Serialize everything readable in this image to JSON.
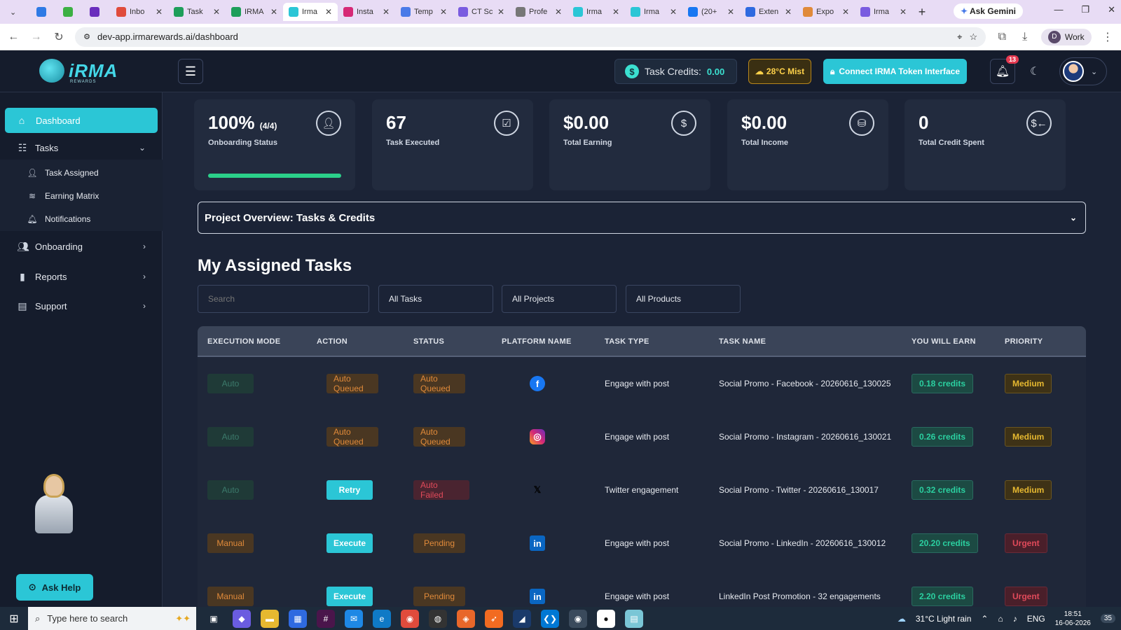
{
  "browser": {
    "tabs": [
      {
        "title": "",
        "color": "#2f7ae5"
      },
      {
        "title": "",
        "color": "#3cb043"
      },
      {
        "title": "",
        "color": "#6a2dbd"
      },
      {
        "title": "Inbo",
        "color": "#e04b3c"
      },
      {
        "title": "Task",
        "color": "#1e9e5a"
      },
      {
        "title": "IRMA",
        "color": "#1e9e5a"
      },
      {
        "title": "Irma",
        "color": "#2bc6d6"
      },
      {
        "title": "Insta",
        "color": "#d62976"
      },
      {
        "title": "Temp",
        "color": "#4a7be8"
      },
      {
        "title": "CT Sc",
        "color": "#7a5ce0"
      },
      {
        "title": "Profe",
        "color": "#777777"
      },
      {
        "title": "Irma",
        "color": "#2bc6d6"
      },
      {
        "title": "Irma",
        "color": "#2bc6d6"
      },
      {
        "title": "(20+",
        "color": "#1877f2"
      },
      {
        "title": "Exten",
        "color": "#2f6ae0"
      },
      {
        "title": "Expo",
        "color": "#e08a3a"
      },
      {
        "title": "Irma",
        "color": "#7a5ce0"
      }
    ],
    "active_tab_index": 6,
    "ask_gemini": "Ask Gemini",
    "url": "dev-app.irmarewards.ai/dashboard",
    "profile_initial": "D",
    "profile_name": "Work"
  },
  "header": {
    "logo_text": "iRMA",
    "logo_sub": "REWARDS",
    "credits_label": "Task Credits:",
    "credits_value": "0.00",
    "weather": "28°C Mist",
    "connect_label": "Connect IRMA Token Interface",
    "notification_count": "13"
  },
  "sidebar": {
    "dashboard": "Dashboard",
    "tasks": "Tasks",
    "task_assigned": "Task Assigned",
    "earning_matrix": "Earning Matrix",
    "notifications": "Notifications",
    "onboarding": "Onboarding",
    "reports": "Reports",
    "support": "Support",
    "ask_help": "Ask Help"
  },
  "stats": [
    {
      "value": "100%",
      "extra": "(4/4)",
      "label": "Onboarding Status",
      "icon": "user-icon",
      "progress": 1.0
    },
    {
      "value": "67",
      "extra": "",
      "label": "Task Executed",
      "icon": "clipboard-check-icon"
    },
    {
      "value": "$0.00",
      "extra": "",
      "label": "Total Earning",
      "icon": "dollar-icon"
    },
    {
      "value": "$0.00",
      "extra": "",
      "label": "Total Income",
      "icon": "coins-icon"
    },
    {
      "value": "0",
      "extra": "",
      "label": "Total Credit Spent",
      "icon": "dollar-arrow-icon"
    }
  ],
  "overview": {
    "title": "Project Overview: Tasks & Credits"
  },
  "tasks_section": {
    "title": "My Assigned Tasks",
    "search_placeholder": "Search",
    "filter_tasks": "All Tasks",
    "filter_projects": "All Projects",
    "filter_products": "All Products"
  },
  "table": {
    "headers": [
      "EXECUTION MODE",
      "ACTION",
      "STATUS",
      "PLATFORM NAME",
      "TASK TYPE",
      "TASK NAME",
      "YOU WILL EARN",
      "PRIORITY"
    ],
    "rows": [
      {
        "mode": "Auto",
        "action": "Auto Queued",
        "status": "Auto Queued",
        "platform": "facebook",
        "task_type": "Engage with post",
        "task_name": "Social Promo - Facebook - 20260616_130025",
        "earn": "0.18 credits",
        "priority": "Medium"
      },
      {
        "mode": "Auto",
        "action": "Auto Queued",
        "status": "Auto Queued",
        "platform": "instagram",
        "task_type": "Engage with post",
        "task_name": "Social Promo - Instagram - 20260616_130021",
        "earn": "0.26 credits",
        "priority": "Medium"
      },
      {
        "mode": "Auto",
        "action": "Retry",
        "status": "Auto Failed",
        "platform": "twitter",
        "task_type": "Twitter engagement",
        "task_name": "Social Promo - Twitter - 20260616_130017",
        "earn": "0.32 credits",
        "priority": "Medium"
      },
      {
        "mode": "Manual",
        "action": "Execute",
        "status": "Pending",
        "platform": "linkedin",
        "task_type": "Engage with post",
        "task_name": "Social Promo - LinkedIn - 20260616_130012",
        "earn": "20.20 credits",
        "priority": "Urgent"
      },
      {
        "mode": "Manual",
        "action": "Execute",
        "status": "Pending",
        "platform": "linkedin",
        "task_type": "Engage with post",
        "task_name": "LinkedIn Post Promotion - 32 engagements",
        "earn": "2.20 credits",
        "priority": "Urgent"
      }
    ]
  },
  "taskbar": {
    "search_placeholder": "Type here to search",
    "weather": "31°C Light rain",
    "lang": "ENG",
    "time": "18:51",
    "date": "16-06-2026",
    "notif_count": "35"
  },
  "colors": {
    "accent": "#2bc6d6",
    "success": "#2bd08a",
    "warning": "#e08a3a",
    "danger": "#e04a5a"
  }
}
